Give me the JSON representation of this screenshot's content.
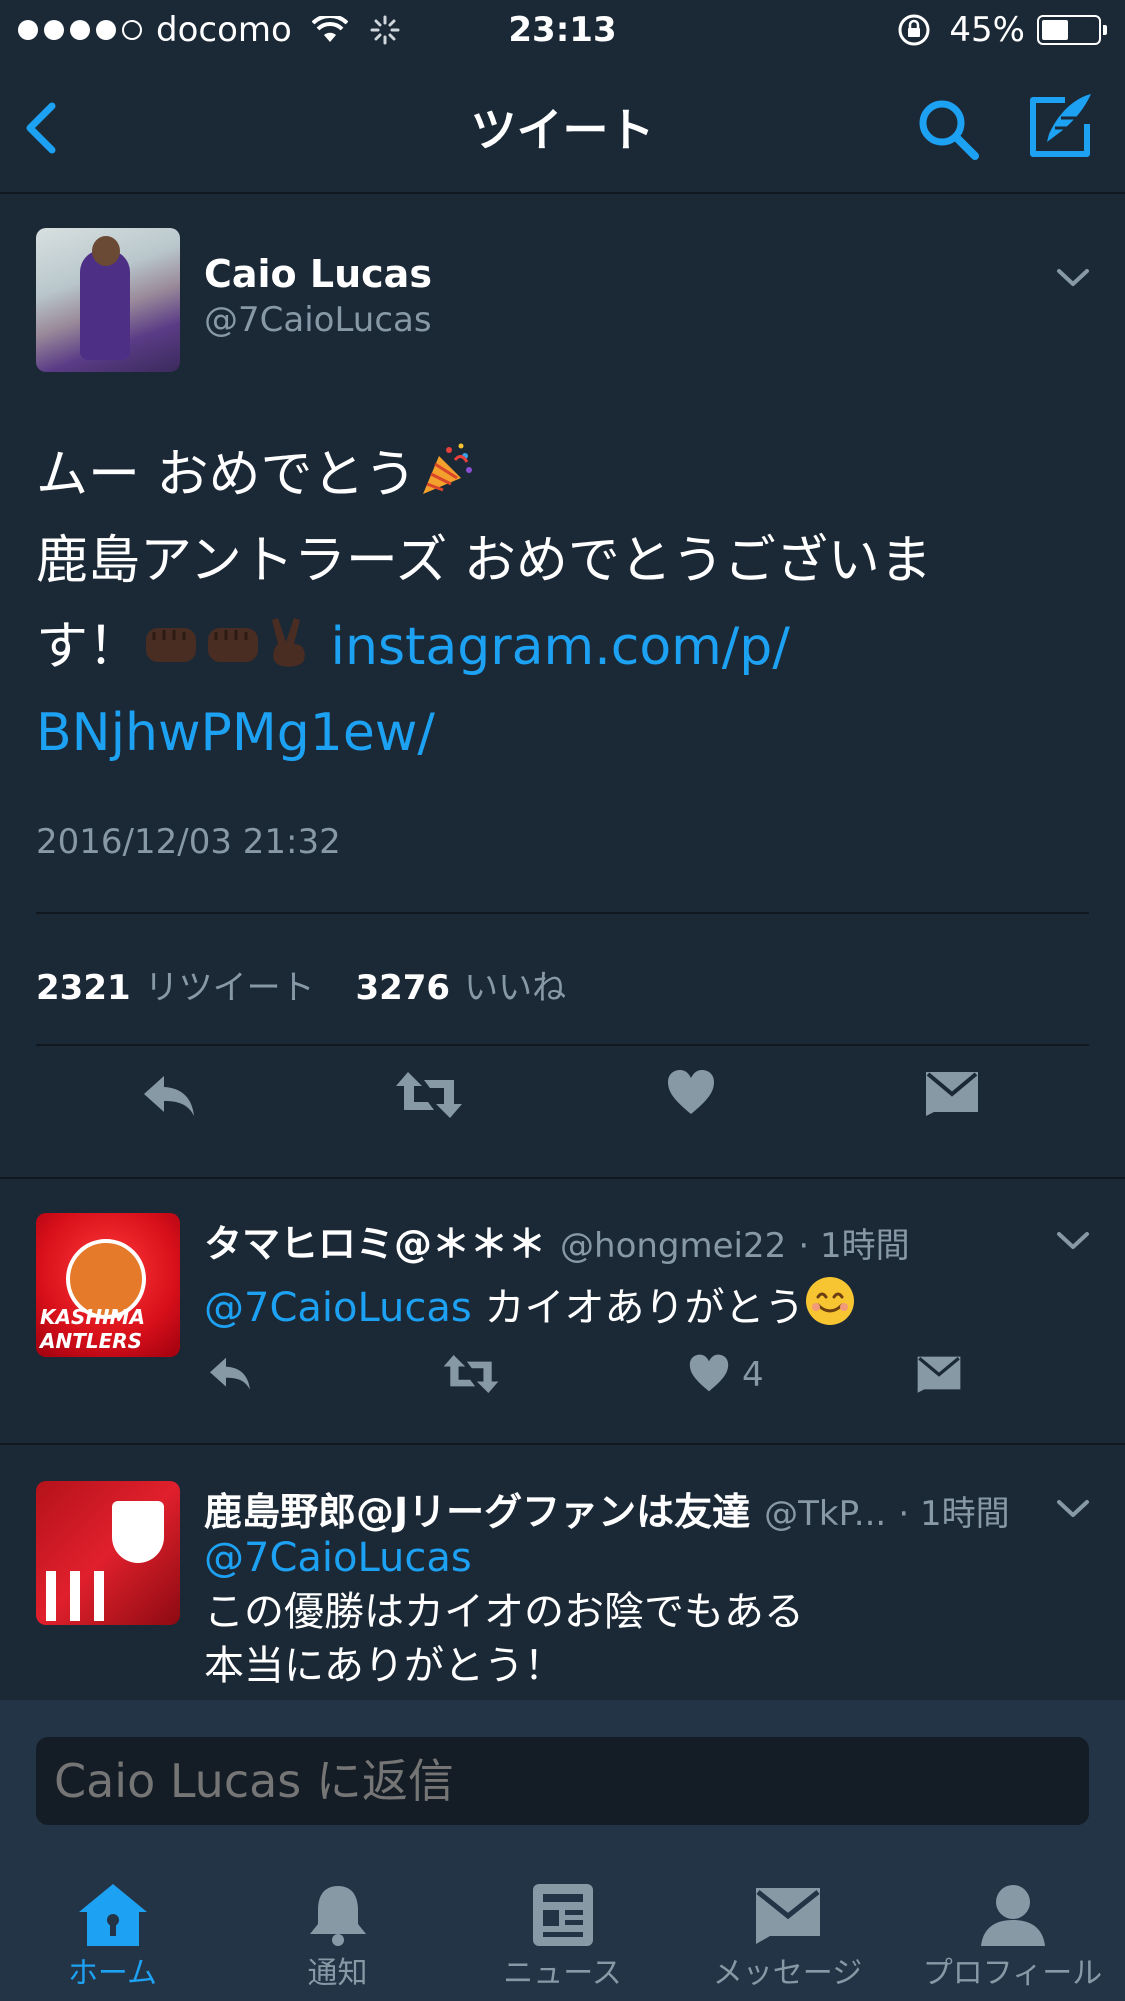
{
  "status_bar": {
    "carrier": "docomo",
    "time": "23:13",
    "battery_percent": "45%",
    "battery_level": 0.45,
    "signal_bars": 4
  },
  "nav": {
    "title": "ツイート",
    "back_icon": "chevron-left-icon",
    "search_icon": "search-icon",
    "compose_icon": "compose-icon"
  },
  "tweet": {
    "name": "Caio Lucas",
    "handle": "@7CaioLucas",
    "line1": "ムー おめでとう",
    "line2": "鹿島アントラーズ おめでとうございま",
    "line3": "す！",
    "link1": "instagram.com/p/",
    "link2": "BNjhwPMg1ew/",
    "timestamp": "2016/12/03 21:32",
    "retweet_count": "2321",
    "retweet_label": "リツイート",
    "like_count": "3276",
    "like_label": "いいね"
  },
  "replies": [
    {
      "name": "タマヒロミ@＊＊＊",
      "handle": "@hongmei22",
      "time": "· 1時間",
      "mention": "@7CaioLucas",
      "text": " カイオありがとう",
      "like_count": "4",
      "avatar_label": "KASHIMA ANTLERS"
    },
    {
      "name": "鹿島野郎@Jリーグファンは友達",
      "handle": "@TkP...",
      "time": "· 1時間",
      "mention": "@7CaioLucas",
      "text_line1": "この優勝はカイオのお陰でもある",
      "text_line2": "本当にありがとう！"
    }
  ],
  "reply_input": {
    "placeholder": "Caio Lucas に返信"
  },
  "tabs": [
    {
      "label": "ホーム",
      "icon": "home-icon",
      "active": true
    },
    {
      "label": "通知",
      "icon": "bell-icon",
      "active": false
    },
    {
      "label": "ニュース",
      "icon": "news-icon",
      "active": false
    },
    {
      "label": "メッセージ",
      "icon": "envelope-icon",
      "active": false
    },
    {
      "label": "プロフィール",
      "icon": "person-icon",
      "active": false
    }
  ],
  "colors": {
    "background": "#1b2836",
    "bar": "#243447",
    "accent": "#1da1f2",
    "secondary_text": "#8899a6"
  }
}
